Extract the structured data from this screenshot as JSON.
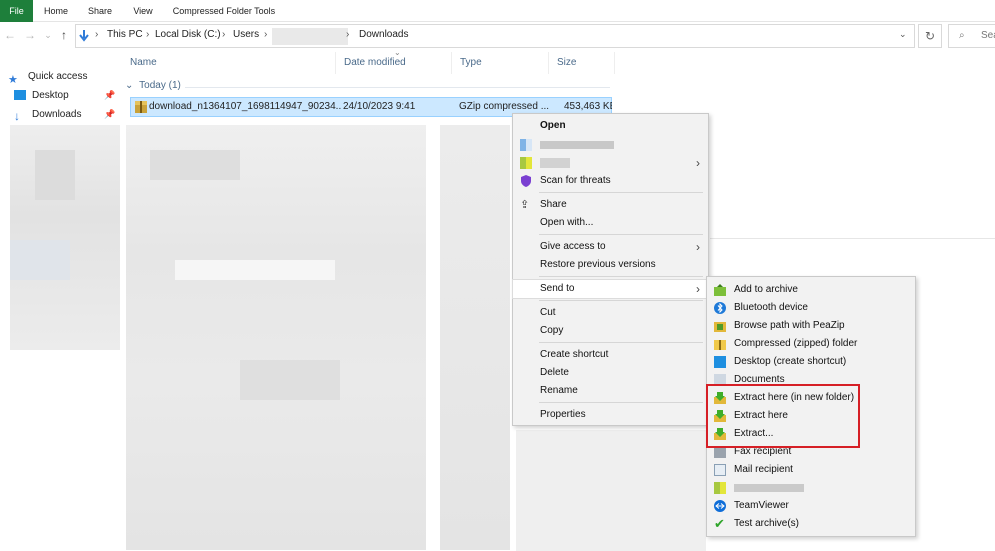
{
  "ribbon": {
    "tabs": [
      "File",
      "Home",
      "Share",
      "View",
      "Compressed Folder Tools"
    ]
  },
  "address": {
    "back_icon": "arrow-left-icon",
    "segments": [
      "This PC",
      "Local Disk (C:)",
      "Users",
      "Downloads"
    ],
    "search_placeholder": "Sea"
  },
  "nav": {
    "quick_access": "Quick access",
    "items": [
      "Desktop",
      "Downloads"
    ]
  },
  "columns": [
    "Name",
    "Date modified",
    "Type",
    "Size"
  ],
  "group": "Today (1)",
  "file": {
    "name": "download_n1364107_1698114947_90234...",
    "date": "24/10/2023 9:41",
    "type": "GZip compressed ...",
    "size": "453,463 KB"
  },
  "context_menu": {
    "open": "Open",
    "scan": "Scan for threats",
    "share": "Share",
    "open_with": "Open with...",
    "give_access": "Give access to",
    "restore": "Restore previous versions",
    "send_to": "Send to",
    "cut": "Cut",
    "copy": "Copy",
    "create_shortcut": "Create shortcut",
    "delete": "Delete",
    "rename": "Rename",
    "properties": "Properties"
  },
  "send_to_menu": {
    "items": [
      "Add to archive",
      "Bluetooth device",
      "Browse path with PeaZip",
      "Compressed (zipped) folder",
      "Desktop (create shortcut)",
      "Documents",
      "Extract here (in new folder)",
      "Extract here",
      "Extract...",
      "Fax recipient",
      "Mail recipient",
      "",
      "TeamViewer",
      "Test archive(s)"
    ]
  },
  "colors": {
    "file_tab": "#1e7f3b",
    "selection": "#cce8ff",
    "highlight_box": "#d61f26"
  }
}
